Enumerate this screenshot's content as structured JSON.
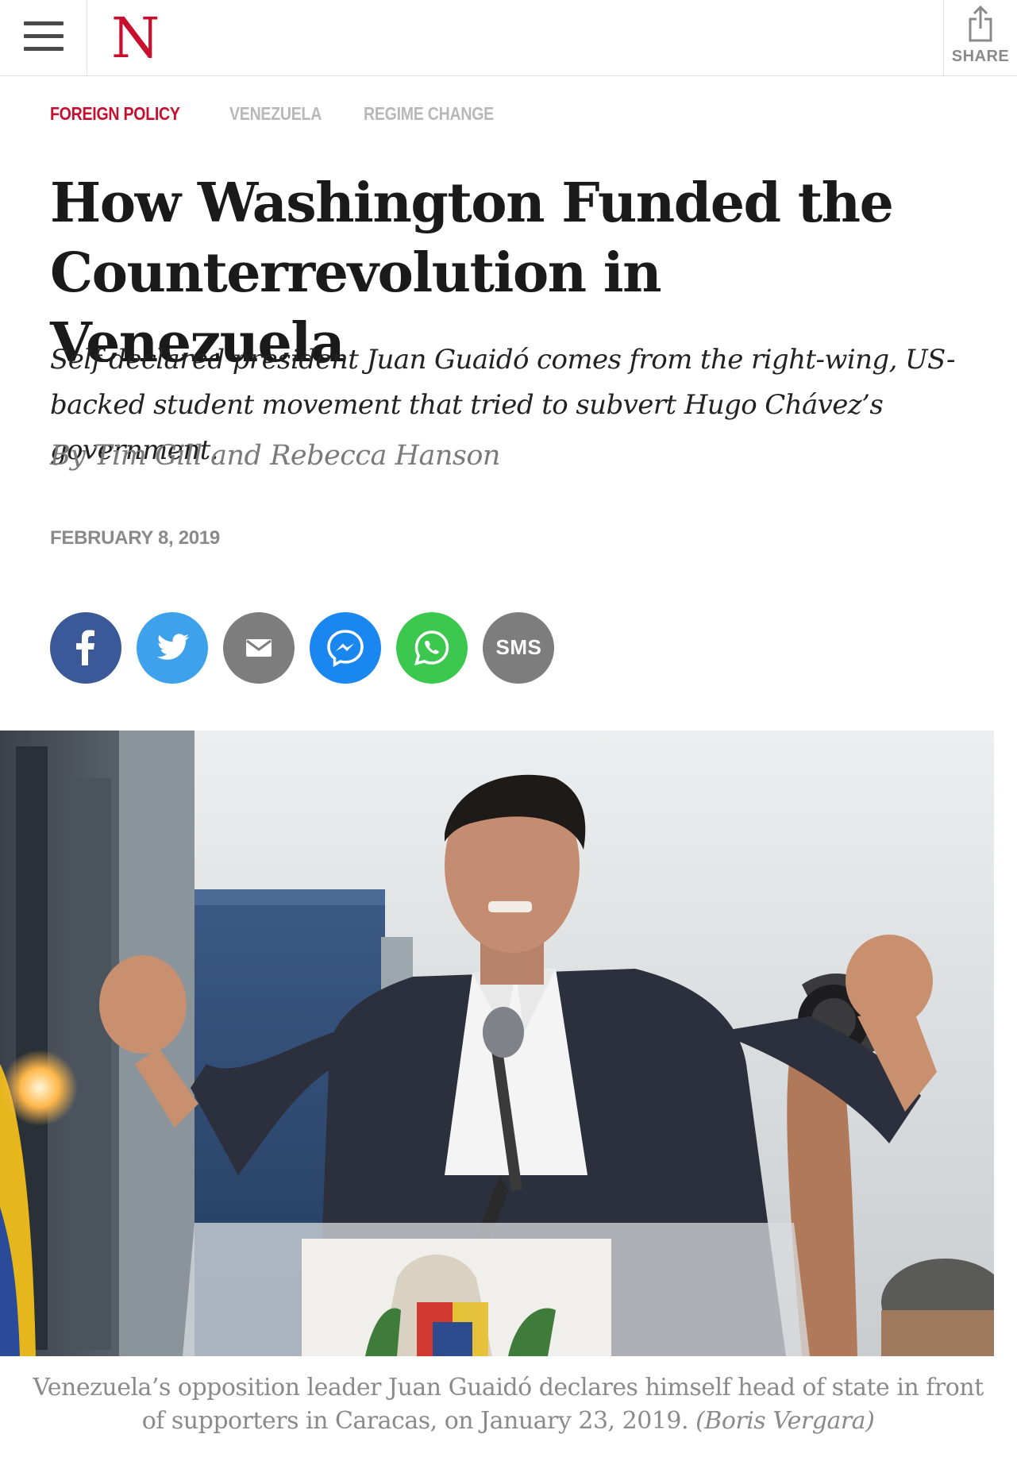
{
  "header": {
    "logo": "N",
    "share_label": "SHARE"
  },
  "tags": [
    "FOREIGN POLICY",
    "VENEZUELA",
    "REGIME CHANGE"
  ],
  "article": {
    "headline_line1": "How Washington Funded the",
    "headline_line2": "Counterrevolution in Venezuela",
    "dek_line1": "Self-declared president Juan Guaidó comes from the right-wing, US-",
    "dek_line2": "backed student movement that tried to subvert Hugo Chávez’s government.",
    "byline": "By Tim Gill and Rebecca Hanson",
    "date": "FEBRUARY 8, 2019"
  },
  "social": {
    "sms_label": "SMS",
    "colors": {
      "facebook": "#3b5998",
      "twitter": "#3ea1ec",
      "email": "#7d7d7d",
      "messenger": "#1a86f0",
      "whatsapp": "#3cc84f",
      "sms": "#7d7d7d"
    }
  },
  "photo": {
    "caption_line1": "Venezuela’s opposition leader Juan Guaidó declares himself head of state in front",
    "caption_line2": "of supporters in Caracas, on January 23, 2019.",
    "credit": "(Boris Vergara)"
  },
  "colors": {
    "brand_red": "#c8102e",
    "tag_gray": "#b8b8b8"
  }
}
